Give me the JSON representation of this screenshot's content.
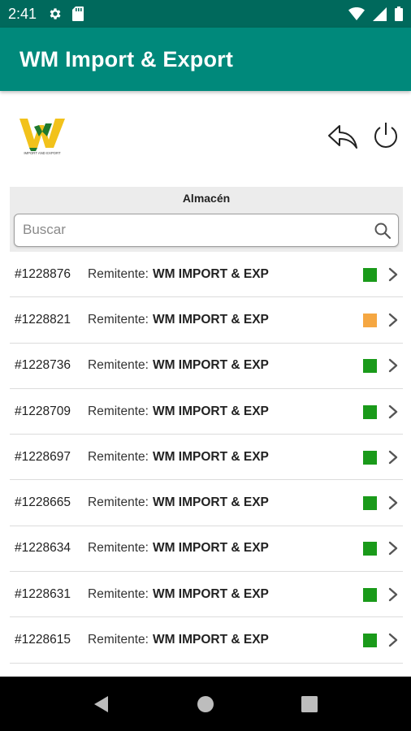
{
  "status_bar": {
    "time": "2:41",
    "icons": [
      "settings-icon",
      "sd-card-icon",
      "wifi-icon",
      "signal-icon",
      "battery-icon"
    ]
  },
  "app_bar": {
    "title": "WM Import & Export"
  },
  "header": {
    "logo_text": "IMPORT AND EXPORT",
    "back_icon": "reply-icon",
    "power_icon": "power-icon"
  },
  "section": {
    "title": "Almacén"
  },
  "search": {
    "placeholder": "Buscar",
    "value": ""
  },
  "colors": {
    "status_green": "#1a9a1a",
    "status_orange": "#f5a742",
    "app_bar": "#00897b",
    "status_bar": "#00695c"
  },
  "shipments": [
    {
      "id": "#1228876",
      "label": "Remitente:",
      "sender": "WM IMPORT & EXP",
      "status": "green"
    },
    {
      "id": "#1228821",
      "label": "Remitente:",
      "sender": "WM IMPORT & EXP",
      "status": "orange"
    },
    {
      "id": "#1228736",
      "label": "Remitente:",
      "sender": "WM IMPORT & EXP",
      "status": "green"
    },
    {
      "id": "#1228709",
      "label": "Remitente:",
      "sender": "WM IMPORT & EXP",
      "status": "green"
    },
    {
      "id": "#1228697",
      "label": "Remitente:",
      "sender": "WM IMPORT & EXP",
      "status": "green"
    },
    {
      "id": "#1228665",
      "label": "Remitente:",
      "sender": "WM IMPORT & EXP",
      "status": "green"
    },
    {
      "id": "#1228634",
      "label": "Remitente:",
      "sender": "WM IMPORT & EXP",
      "status": "green"
    },
    {
      "id": "#1228631",
      "label": "Remitente:",
      "sender": "WM IMPORT & EXP",
      "status": "green"
    },
    {
      "id": "#1228615",
      "label": "Remitente:",
      "sender": "WM IMPORT & EXP",
      "status": "green"
    }
  ],
  "nav": {
    "icons": [
      "back-triangle-icon",
      "home-circle-icon",
      "recents-square-icon"
    ]
  }
}
